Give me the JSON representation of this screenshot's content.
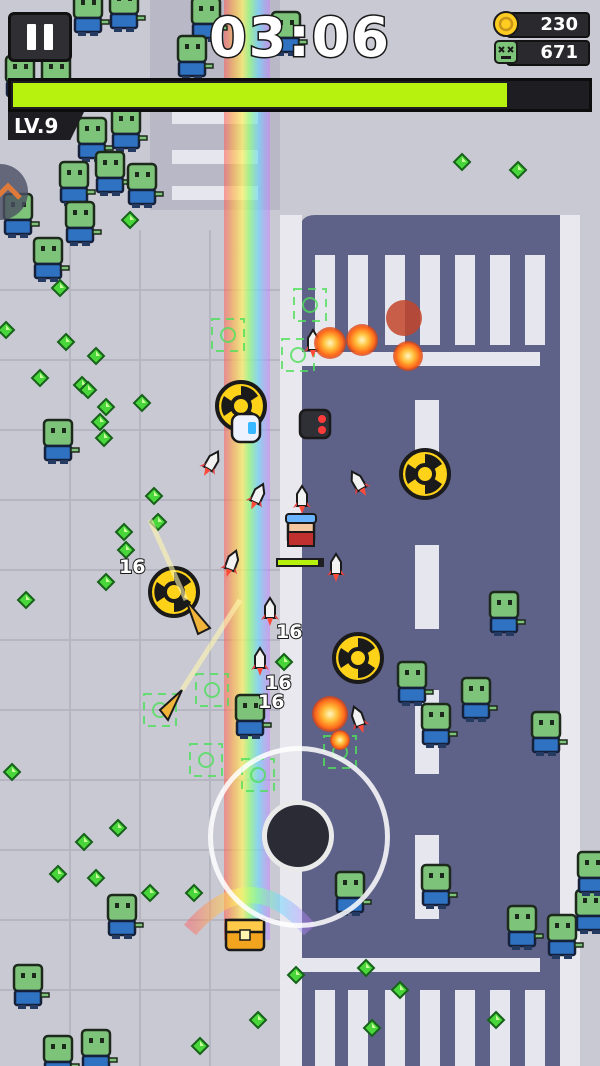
{
  "hud": {
    "timer": "03:06",
    "coins": "230",
    "kills": "671",
    "level": "LV.9",
    "xp_fraction": 0.86
  },
  "icons": {
    "pause": "pause-icon",
    "coin": "coin-icon",
    "kill": "zombie-skull-icon"
  },
  "damage_numbers": [
    "16",
    "16",
    "16",
    "16"
  ],
  "colors": {
    "xp_fill": "#b7f20f",
    "road": "#5e6288",
    "sidewalk": "#c9c9d4",
    "zombie_skin": "#7ec37a",
    "zombie_shirt": "#2f72c2",
    "gem": "#48d63a"
  }
}
